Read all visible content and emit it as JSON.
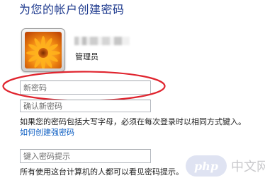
{
  "page": {
    "title": "为您的帐户创建密码"
  },
  "account": {
    "name_blurred": "",
    "role": "管理员"
  },
  "form": {
    "new_password_placeholder": "新密码",
    "confirm_password_placeholder": "确认新密码",
    "hint_placeholder": "键入密码提示",
    "uppercase_note": "如果您的密码包括大写字母，必须在每次登录时以相同方式键入。",
    "strong_password_link": "如何创建强密码",
    "hint_visibility_note": "所有使用这台计算机的人都可以看见密码提示。"
  },
  "annotation": {
    "highlight_color": "#e0242e"
  },
  "watermark": {
    "badge": "php",
    "text": "中文网"
  },
  "colors": {
    "title": "#1e3a8e",
    "link": "#0a5cc2"
  }
}
